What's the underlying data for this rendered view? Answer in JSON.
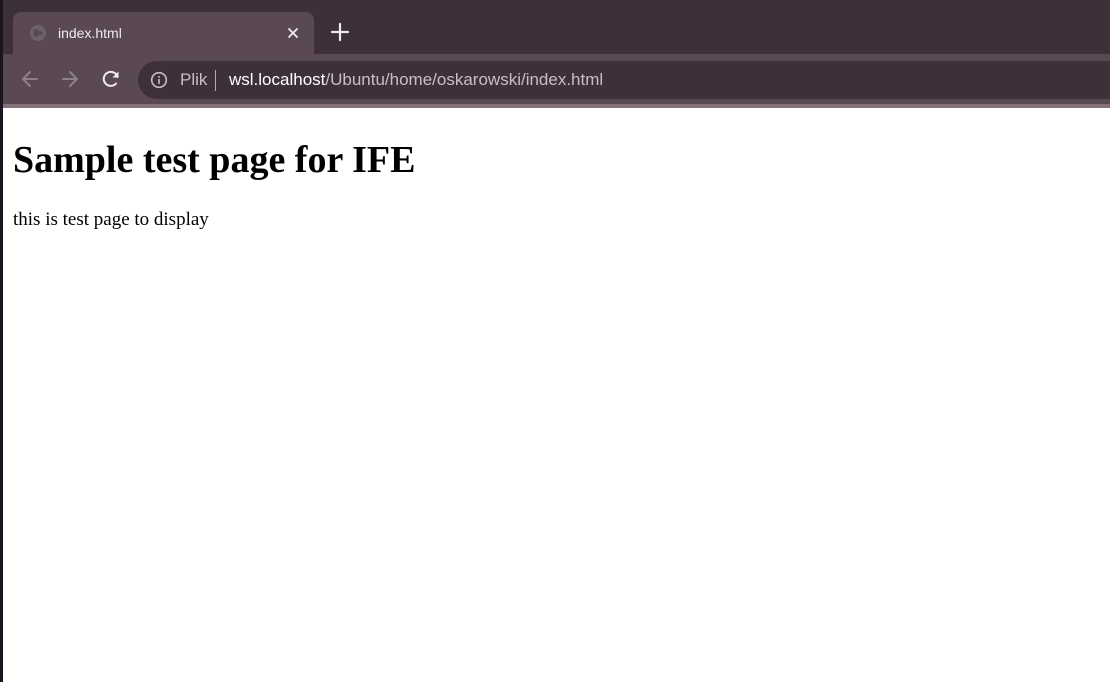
{
  "browser": {
    "tab": {
      "title": "index.html",
      "favicon": "globe-icon",
      "close_icon": "close-icon"
    },
    "new_tab_icon": "plus-icon",
    "nav": {
      "back_icon": "arrow-left-icon",
      "forward_icon": "arrow-right-icon",
      "reload_icon": "reload-icon"
    },
    "address_bar": {
      "security_icon": "info-icon",
      "scheme_label": "Plik",
      "host": "wsl.localhost",
      "path": "/Ubuntu/home/oskarowski/index.html"
    },
    "colors": {
      "tab_strip": "#3d3039",
      "toolbar": "#5a4853",
      "omnibox": "#3e3039"
    }
  },
  "page": {
    "heading": "Sample test page for IFE",
    "paragraph": "this is test page to display"
  }
}
